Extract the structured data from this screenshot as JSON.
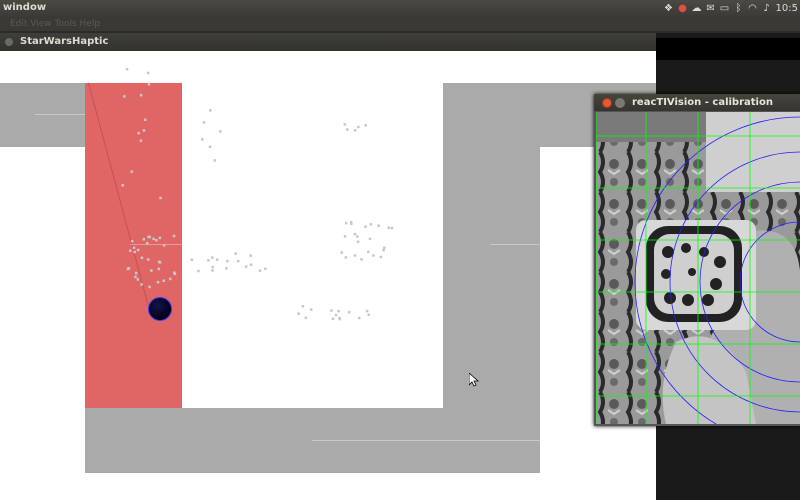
{
  "top_panel": {
    "title": "window",
    "clock": "10:5",
    "icons": [
      "dropbox-icon",
      "mic-icon",
      "cloud-icon",
      "mail-icon",
      "chat-icon",
      "bluetooth-icon",
      "wifi-icon",
      "volume-icon"
    ]
  },
  "menu_ghost": "Edit  View  Tools  Help",
  "main_window": {
    "title": "StarWarsHaptic"
  },
  "calibration_window": {
    "title": "reacTIVision - calibration"
  },
  "colors": {
    "red_zone": "#e06666",
    "gray_block": "#aaaaaa",
    "grid_green": "#00ff00",
    "arc_blue": "#2020ff",
    "close_button": "#e25a2f"
  }
}
